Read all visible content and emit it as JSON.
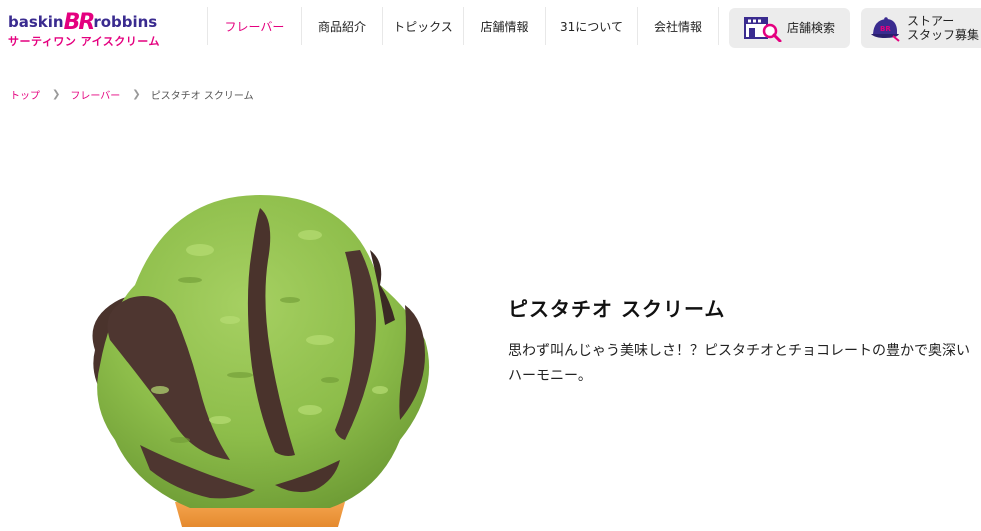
{
  "brand": {
    "logo_top_a": "baskin",
    "logo_top_br": "BR",
    "logo_top_b": "robbins",
    "logo_bottom": "サーティワン アイスクリーム"
  },
  "nav": {
    "items": [
      {
        "label": "フレーバー",
        "active": true
      },
      {
        "label": "商品紹介",
        "active": false
      },
      {
        "label": "トピックス",
        "active": false
      },
      {
        "label": "店舗情報",
        "active": false
      },
      {
        "label": "31について",
        "active": false
      },
      {
        "label": "会社情報",
        "active": false
      }
    ],
    "store_search": {
      "label": "店舗検索",
      "icon": "store-search-icon"
    },
    "recruit": {
      "label_line1": "ストアー",
      "label_line2": "スタッフ募集",
      "icon": "staff-cap-icon"
    }
  },
  "breadcrumb": {
    "items": [
      "トップ",
      "フレーバー"
    ],
    "current": "ピスタチオ スクリーム"
  },
  "product": {
    "name": "ピスタチオ スクリーム",
    "description": "思わず叫んじゃう美味しさ！？ピスタチオとチョコレートの豊かで奥深いハーモニー。",
    "image": "pistachio-chocolate-ice-cream-scoop-on-cone"
  },
  "colors": {
    "accent": "#e4007f",
    "brand_blue": "#3a2b8f",
    "pistachio": "#8dbd4a",
    "chocolate": "#4a332c",
    "button_bg": "#ececec"
  }
}
